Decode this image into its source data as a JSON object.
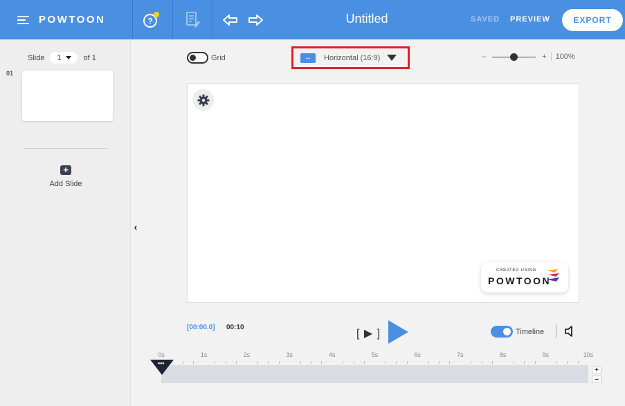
{
  "app": {
    "logo": "POWTOON"
  },
  "header": {
    "title": "Untitled",
    "saved_label": "SAVED",
    "preview_label": "PREVIEW",
    "export_label": "EXPORT",
    "icons": [
      "menu-icon",
      "help-icon",
      "notes-icon",
      "undo-icon",
      "redo-icon"
    ],
    "accent_color": "#4a90e2"
  },
  "slides_panel": {
    "slide_label": "Slide",
    "current_slide": "1",
    "of_label": "of 1",
    "slide_number": "01",
    "add_slide_label": "Add Slide"
  },
  "toolbar": {
    "grid_label": "Grid",
    "grid_on": false,
    "aspect_ratio": "Horizontal (16:9)",
    "zoom_minus": "–",
    "zoom_plus": "+",
    "zoom_value": "100%"
  },
  "canvas": {
    "badge_small_text": "CREATED USING",
    "badge_logo": "POWTOON"
  },
  "playback": {
    "current_time": "[00:00.0]",
    "total_time": "00:10",
    "play_slide_label": "[ ▶ ]",
    "timeline_label": "Timeline",
    "timeline_on": true
  },
  "timeline": {
    "ticks": [
      "0s",
      "1s",
      "2s",
      "3s",
      "4s",
      "5s",
      "6s",
      "7s",
      "8s",
      "9s",
      "10s"
    ],
    "zoom_in": "+",
    "zoom_out": "–",
    "playhead_label": "•••"
  }
}
